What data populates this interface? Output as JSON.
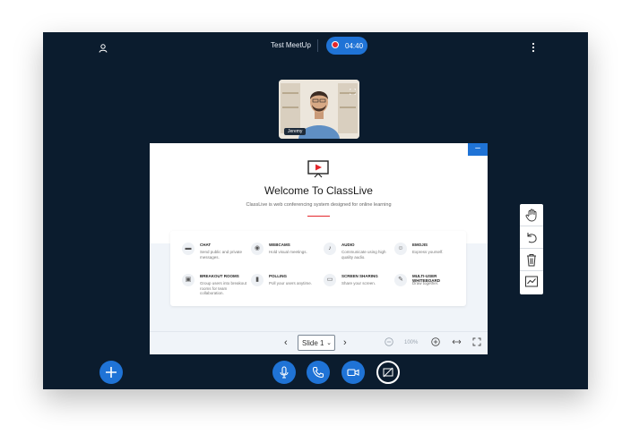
{
  "header": {
    "title": "Test MeetUp",
    "recording_time": "04:40",
    "user_icon": "user-icon",
    "menu_icon": "kebab-menu-icon"
  },
  "webcam": {
    "name": "Jeremy"
  },
  "slide": {
    "title": "Welcome To ClassLive",
    "subtitle": "ClassLive is web conferencing system designed for online learning",
    "minimize_label": "–",
    "features": [
      {
        "icon": "chat-icon",
        "title": "CHAT",
        "desc": "Send public and private messages."
      },
      {
        "icon": "webcam-icon",
        "title": "WEBCAMS",
        "desc": "Hold visual meetings."
      },
      {
        "icon": "audio-icon",
        "title": "AUDIO",
        "desc": "Communicate using high quality audio."
      },
      {
        "icon": "emoji-icon",
        "title": "EMOJIS",
        "desc": "Express yourself."
      },
      {
        "icon": "breakout-icon",
        "title": "BREAKOUT ROOMS",
        "desc": "Group users into breakout rooms for team collaboration."
      },
      {
        "icon": "polling-icon",
        "title": "POLLING",
        "desc": "Poll your users anytime."
      },
      {
        "icon": "screen-icon",
        "title": "SCREEN SHARING",
        "desc": "Share your screen."
      },
      {
        "icon": "whiteboard-icon",
        "title": "MULTI-USER WHITEBOARD",
        "desc": "Draw together."
      }
    ]
  },
  "slide_controls": {
    "selected_slide": "Slide 1",
    "zoom": "100%"
  },
  "colors": {
    "accent": "#1f73d6",
    "background": "#0b1c2e",
    "record": "#e4262b"
  }
}
